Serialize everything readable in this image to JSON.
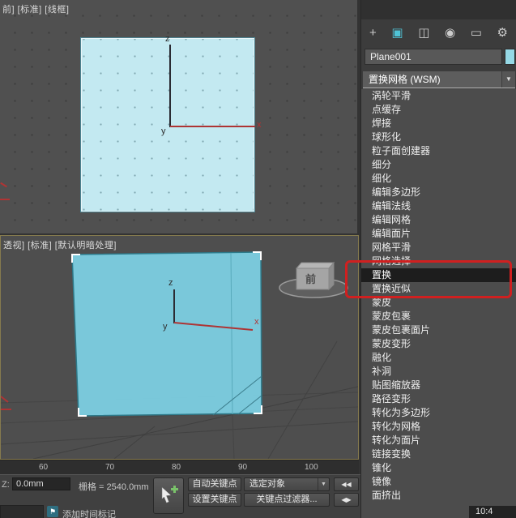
{
  "viewports": {
    "top": {
      "label": "前] [标准] [线框]",
      "axis": {
        "x": "x",
        "y": "y",
        "z": "z"
      }
    },
    "perspective": {
      "label": "透视] [标准] [默认明暗处理]",
      "axis": {
        "x": "x",
        "y": "y",
        "z": "z"
      },
      "view_cube_label": "前"
    }
  },
  "panel": {
    "tabs": [
      {
        "name": "create",
        "glyph": "+",
        "active": false
      },
      {
        "name": "modify",
        "glyph": "▣",
        "active": true
      },
      {
        "name": "hierarchy",
        "glyph": "◫",
        "active": false
      },
      {
        "name": "motion",
        "glyph": "◉",
        "active": false
      },
      {
        "name": "display",
        "glyph": "▭",
        "active": false
      },
      {
        "name": "utilities",
        "glyph": "⚙",
        "active": false
      }
    ],
    "object_name": "Plane001",
    "object_color": "#96d9e6",
    "modifier_dropdown": {
      "selected": "置换网格 (WSM)",
      "arrow": "▼"
    },
    "highlighted_modifier": "置换",
    "modifiers": [
      "涡轮平滑",
      "点缓存",
      "焊接",
      "球形化",
      "粒子面创建器",
      "细分",
      "细化",
      "编辑多边形",
      "编辑法线",
      "编辑网格",
      "编辑面片",
      "网格平滑",
      "网格选择",
      "置换",
      "置换近似",
      "蒙皮",
      "蒙皮包裹",
      "蒙皮包裹面片",
      "蒙皮变形",
      "融化",
      "补洞",
      "贴图缩放器",
      "路径变形",
      "转化为多边形",
      "转化为网格",
      "转化为面片",
      "链接变换",
      "锥化",
      "镜像",
      "面挤出"
    ]
  },
  "timeline": {
    "ticks": [
      "60",
      "70",
      "80",
      "90",
      "100"
    ]
  },
  "statusbar": {
    "z_label": "Z:",
    "z_value": "0.0mm",
    "grid_label": "栅格 = 2540.0mm",
    "auto_key": "自动关键点",
    "set_key": "设置关键点",
    "selection_filter": "选定对象",
    "key_filters": "关键点过滤器...",
    "add_time_tag": "添加时间标记",
    "time_tag_glyph": "⚑",
    "dropdown_arrow": "▼",
    "nav_prev": "◀◀",
    "nav_next": "◀▶"
  },
  "annotation": {
    "color": "#d02020"
  },
  "clock": "10:4"
}
